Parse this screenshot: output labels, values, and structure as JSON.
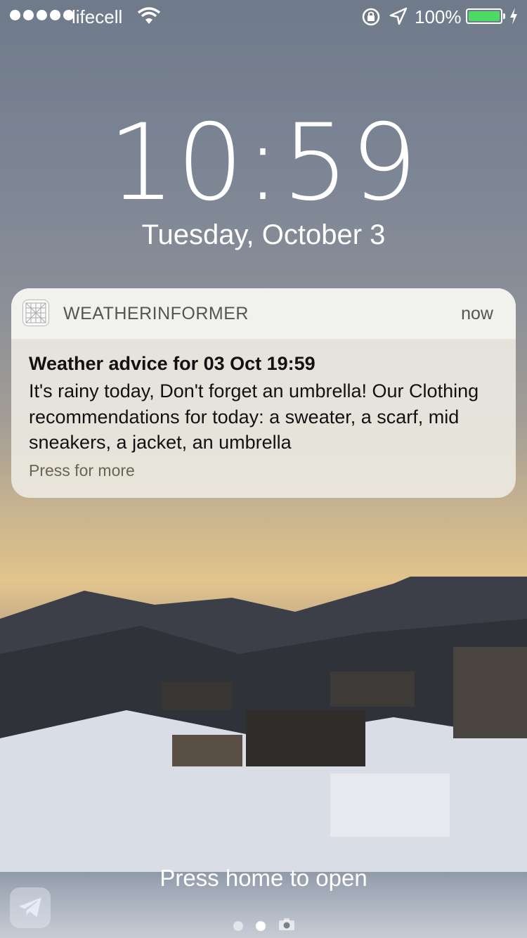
{
  "status_bar": {
    "carrier": "lifecell",
    "battery_percent": "100%",
    "battery_level": 1.0,
    "battery_color": "#4cd964",
    "signal_bars": 5,
    "icons": [
      "signal-dots-icon",
      "wifi-icon",
      "rotation-lock-icon",
      "location-arrow-icon",
      "battery-icon",
      "charging-bolt-icon"
    ]
  },
  "lockscreen": {
    "time": "10:59",
    "date": "Tuesday, October 3",
    "press_home": "Press home to open"
  },
  "notification": {
    "app_name": "WEATHERINFORMER",
    "timestamp": "now",
    "title": "Weather advice for 03 Oct 19:59",
    "body": "It's rainy today, Don't forget an umbrella! Our Clothing recommendations for today:  a sweater, a scarf, mid sneakers, a jacket, an umbrella",
    "more": "Press for more",
    "app_icon": "weather-grid-icon"
  },
  "bottom": {
    "left_button_icon": "telegram-icon",
    "pages": [
      "page-dot",
      "page-dot-active",
      "camera-icon"
    ]
  }
}
